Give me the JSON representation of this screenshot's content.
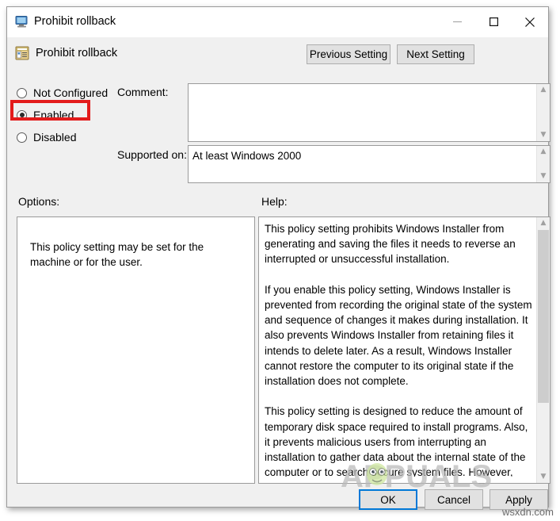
{
  "window": {
    "title": "Prohibit rollback",
    "title_icon": "computer-monitor-icon",
    "controls": {
      "minimize": "minimize-icon",
      "maximize": "maximize-icon",
      "close": "close-icon"
    }
  },
  "header": {
    "icon": "policy-setting-icon",
    "title": "Prohibit rollback",
    "previous_setting_label": "Previous Setting",
    "next_setting_label": "Next Setting"
  },
  "state_options": {
    "items": [
      {
        "label": "Not Configured",
        "selected": false
      },
      {
        "label": "Enabled",
        "selected": true
      },
      {
        "label": "Disabled",
        "selected": false
      }
    ],
    "highlight_color": "#e31b1b",
    "highlighted_item": "Enabled"
  },
  "fields": {
    "comment_label": "Comment:",
    "comment_value": "",
    "supported_on_label": "Supported on:",
    "supported_on_value": "At least Windows 2000"
  },
  "options": {
    "heading": "Options:",
    "text": "This policy setting may be set for the machine or for the user."
  },
  "help": {
    "heading": "Help:",
    "text": "This policy setting prohibits Windows Installer from generating and saving the files it needs to reverse an interrupted or unsuccessful installation.\n\nIf you enable this policy setting, Windows Installer is prevented from recording the original state of the system and sequence of changes it makes during installation. It also prevents Windows Installer from retaining files it intends to delete later. As a result, Windows Installer cannot restore the computer to its original state if the installation does not complete.\n\nThis policy setting is designed to reduce the amount of temporary disk space required to install programs. Also, it prevents malicious users from interrupting an installation to gather data about the internal state of the computer or to search secure system files. However, because an incomplete installation can render the system or a program inoperable, do not use this policy setting unless it is essential.\n\nThis policy setting appears in the Computer Configuration and User Configuration folders. If the policy setting is enabled in"
  },
  "actions": {
    "ok_label": "OK",
    "cancel_label": "Cancel",
    "apply_label": "Apply",
    "focus_color": "#0078d7"
  },
  "watermarks": {
    "brand": "APPUALS",
    "site": "wsxdn.com"
  }
}
